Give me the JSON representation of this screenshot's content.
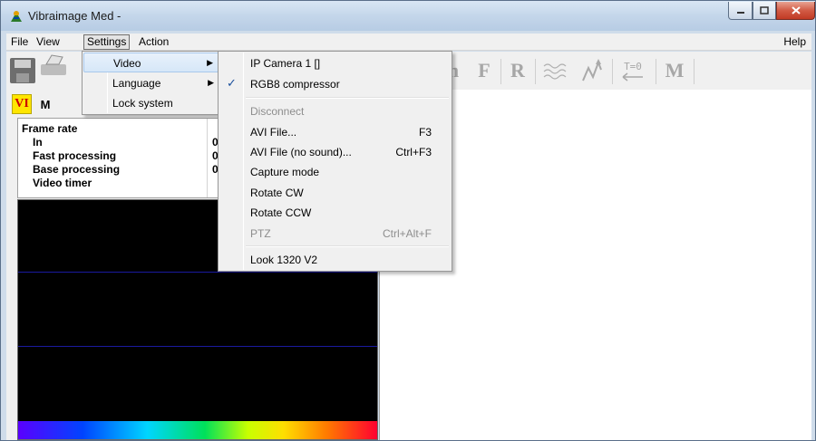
{
  "window": {
    "title": "Vibraimage Med -"
  },
  "menubar": {
    "file": "File",
    "view": "View",
    "settings": "Settings",
    "action": "Action",
    "help": "Help"
  },
  "toolbar": {
    "buttons": [
      "n",
      "F",
      "R",
      "T=0",
      "M"
    ]
  },
  "tabs": {
    "vi": "VI",
    "m": "M"
  },
  "stats": {
    "rows": [
      {
        "label": "Frame rate",
        "value": ""
      },
      {
        "label": "In",
        "value": "0."
      },
      {
        "label": "Fast processing",
        "value": "0."
      },
      {
        "label": "Base processing",
        "value": "0."
      },
      {
        "label": "Video timer",
        "value": ""
      }
    ]
  },
  "settings_menu": {
    "items": [
      {
        "label": "Video",
        "arrow": "▶"
      },
      {
        "label": "Language",
        "arrow": "▶"
      },
      {
        "label": "Lock system"
      }
    ]
  },
  "video_menu": {
    "items": [
      {
        "label": "IP Camera 1 []"
      },
      {
        "label": "RGB8 compressor",
        "check": "✓"
      },
      {
        "label": "Disconnect"
      },
      {
        "label": "AVI File...",
        "shortcut": "F3"
      },
      {
        "label": "AVI File (no sound)...",
        "shortcut": "Ctrl+F3"
      },
      {
        "label": "Capture mode"
      },
      {
        "label": "Rotate CW"
      },
      {
        "label": "Rotate CCW"
      },
      {
        "label": "PTZ",
        "shortcut": "Ctrl+Alt+F"
      },
      {
        "label": "Look 1320 V2"
      }
    ]
  },
  "colors": {
    "accent": "#ffe600",
    "vi_text": "#cc0000",
    "video_bg": "#000000"
  }
}
